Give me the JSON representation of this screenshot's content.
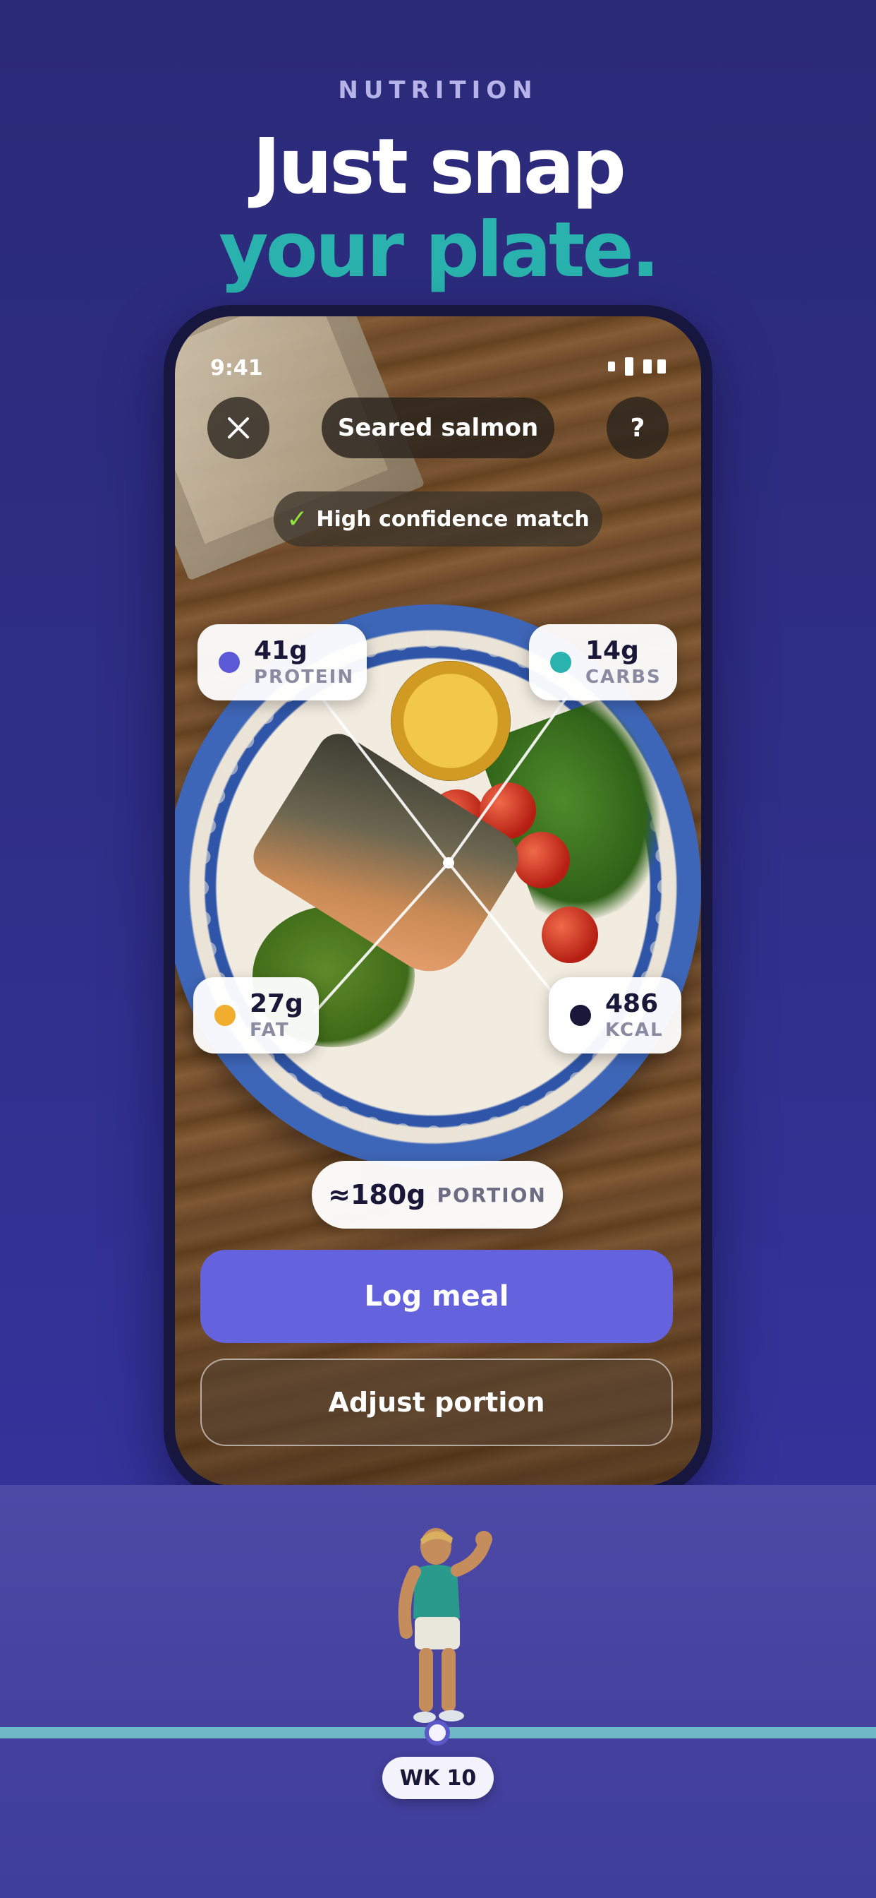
{
  "header": {
    "eyebrow": "NUTRITION",
    "headline_line1": "Just snap",
    "headline_line2": "your plate."
  },
  "status_bar": {
    "time": "9:41"
  },
  "scan": {
    "close_icon": "close-icon",
    "help_label": "?",
    "food_title": "Seared salmon",
    "confidence_check": "✓",
    "confidence_label": "High confidence match"
  },
  "macros": {
    "protein": {
      "value": "41g",
      "label": "PROTEIN",
      "color": "#5b59d6"
    },
    "carbs": {
      "value": "14g",
      "label": "CARBS",
      "color": "#2ab3ae"
    },
    "fat": {
      "value": "27g",
      "label": "FAT",
      "color": "#f0ad2e"
    },
    "kcal": {
      "value": "486",
      "label": "KCAL",
      "color": "#1a1838"
    }
  },
  "portion": {
    "value": "≈180g",
    "label": "PORTION"
  },
  "actions": {
    "log_label": "Log meal",
    "adjust_label": "Adjust portion"
  },
  "progress": {
    "week_label": "WK 10"
  },
  "colors": {
    "accent": "#6462dc",
    "teal": "#2ab3ae",
    "background": "#2f2e86"
  }
}
